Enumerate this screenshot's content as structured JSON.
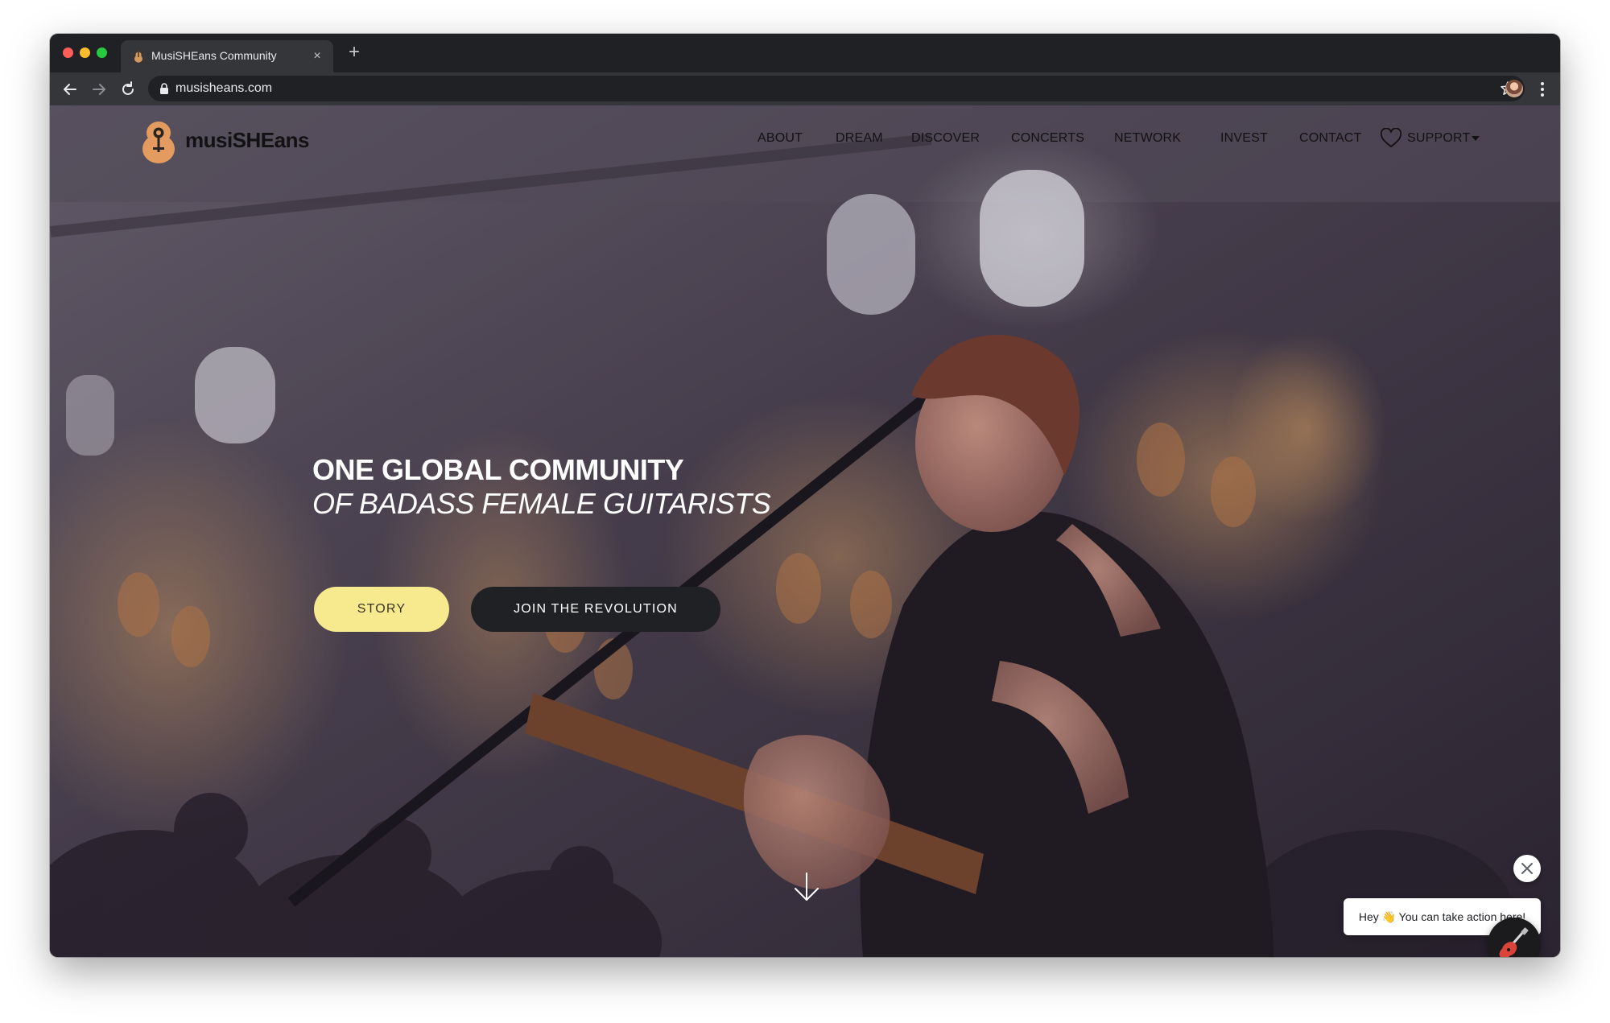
{
  "browser": {
    "tab_title": "MusiSHEans Community",
    "tab_close": "×",
    "new_tab": "+",
    "url": "musisheans.com"
  },
  "site": {
    "logo_text": "musiSHEans",
    "nav": [
      "ABOUT",
      "DREAM",
      "DISCOVER",
      "CONCERTS",
      "NETWORK",
      "INVEST",
      "CONTACT"
    ],
    "support_label": "SUPPORT"
  },
  "hero": {
    "title": "ONE GLOBAL COMMUNITY",
    "subtitle": "OF BADASS FEMALE GUITARISTS",
    "story_button": "STORY",
    "join_button": "JOIN THE REVOLUTION"
  },
  "chat": {
    "greeting": "Hey 👋  You can take action here!"
  },
  "colors": {
    "accent_yellow": "#f7e98e",
    "dark_button": "#202124",
    "chrome_dark": "#202124",
    "chrome_toolbar": "#35363a"
  },
  "icons": [
    "back-icon",
    "forward-icon",
    "reload-icon",
    "lock-icon",
    "star-icon",
    "kebab-menu-icon",
    "guitar-logo-icon",
    "heart-icon",
    "arrow-down-icon",
    "close-icon",
    "guitar-icon"
  ]
}
